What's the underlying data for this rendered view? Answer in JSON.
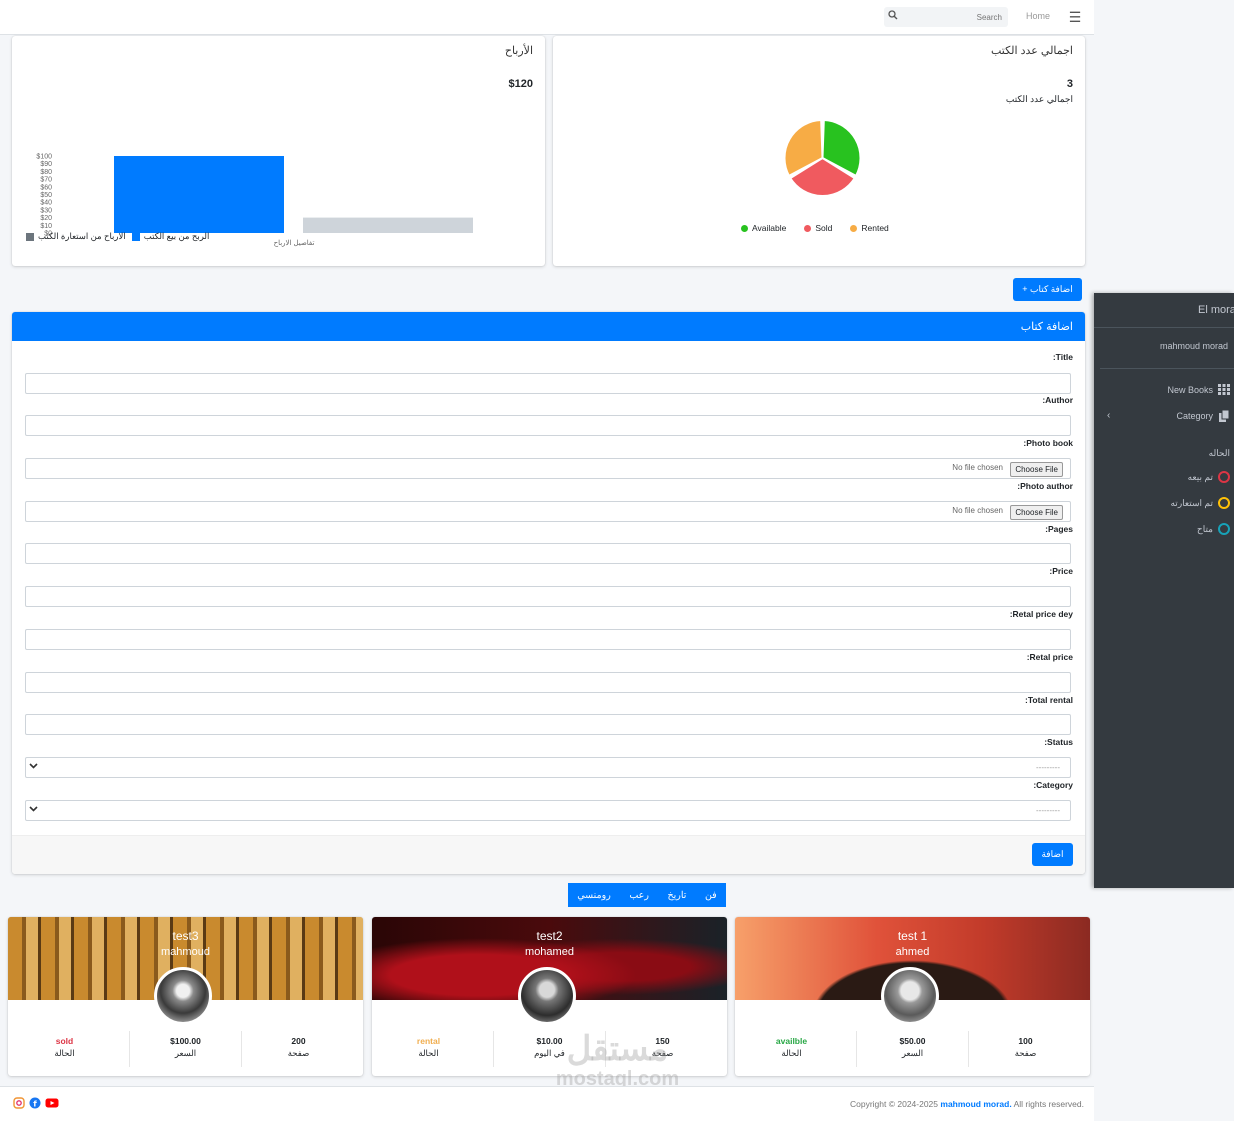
{
  "topbar": {
    "home_label": "Home",
    "search_placeholder": "Search"
  },
  "earnings_card": {
    "title": "الأرباح",
    "amount": "$120",
    "legend": [
      {
        "label": "الربح من بيع الكتب",
        "color": "#007bff"
      },
      {
        "label": "الارباح من استعارة الكتب",
        "color": "#6c757d"
      }
    ]
  },
  "books_card": {
    "title": "اجمالي عدد الكتب",
    "count": "3",
    "count_label": "اجمالي عدد الكتب",
    "legend": [
      {
        "label": "Available",
        "color": "#28c21f"
      },
      {
        "label": "Sold",
        "color": "#f05a5f"
      },
      {
        "label": "Rented",
        "color": "#f7ac45"
      }
    ]
  },
  "chart_data": [
    {
      "type": "bar",
      "categories": [
        "تفاصيل الارباح"
      ],
      "series": [
        {
          "name": "الربح من بيع الكتب",
          "values": [
            100
          ],
          "color": "#007bff"
        },
        {
          "name": "الارباح من استعارة الكتب",
          "values": [
            20
          ],
          "color": "#ced4da"
        }
      ],
      "yticks": [
        "$100",
        "$90",
        "$80",
        "$70",
        "$60",
        "$50",
        "$40",
        "$30",
        "$20",
        "$10",
        "$0"
      ],
      "ylim": [
        0,
        100
      ]
    },
    {
      "type": "pie",
      "labels": [
        "Available",
        "Sold",
        "Rented"
      ],
      "values": [
        1,
        1,
        1
      ],
      "colors": [
        "#28c21f",
        "#f05a5f",
        "#f7ac45"
      ]
    }
  ],
  "add_book_button": "+ اضافة كتاب",
  "form": {
    "header": "اضافة كتاب",
    "fields": [
      {
        "label": ":Title",
        "type": "text"
      },
      {
        "label": ":Author",
        "type": "text"
      },
      {
        "label": ":Photo book",
        "type": "file"
      },
      {
        "label": ":Photo author",
        "type": "file"
      },
      {
        "label": ":Pages",
        "type": "text"
      },
      {
        "label": ":Price",
        "type": "text"
      },
      {
        "label": ":Retal price dey",
        "type": "text"
      },
      {
        "label": ":Retal price",
        "type": "text"
      },
      {
        "label": ":Total rental",
        "type": "text"
      },
      {
        "label": ":Status",
        "type": "select"
      },
      {
        "label": ":Category",
        "type": "select"
      }
    ],
    "choose_file_label": "Choose File",
    "no_file_label": "No file chosen",
    "select_placeholder": "---------",
    "submit_label": "اضافة"
  },
  "genre_tabs": [
    "فن",
    "تاريخ",
    "رعب",
    "رومنسي"
  ],
  "books": [
    {
      "title": "test 1",
      "author": "ahmed",
      "status": "availble",
      "status_color": "#28a745",
      "status_label": "الحالة",
      "price": "$50.00",
      "price_label": "السعر",
      "pages": "100",
      "pages_label": "صفحة"
    },
    {
      "title": "test2",
      "author": "mohamed",
      "status": "rental",
      "status_color": "#f0ad4e",
      "status_label": "الحالة",
      "price": "$10.00",
      "price_label": "في اليوم",
      "pages": "150",
      "pages_label": "صفحة"
    },
    {
      "title": "test3",
      "author": "mahmoud",
      "status": "sold",
      "status_color": "#dc3545",
      "status_label": "الحالة",
      "price": "$100.00",
      "price_label": "السعر",
      "pages": "200",
      "pages_label": "صفحة"
    }
  ],
  "footer": {
    "copyright_prefix": "Copyright © 2024-2025",
    "author": "mahmoud morad.",
    "rights": "All rights reserved."
  },
  "sidebar": {
    "brand": "El morad",
    "user": "mahmoud morad",
    "items": [
      {
        "label": "New Books",
        "icon": "grid-icon"
      },
      {
        "label": "Category",
        "icon": "copy-icon"
      }
    ],
    "status_header": "الحاله",
    "statuses": [
      {
        "label": "تم بيعه",
        "color": "#dc3545"
      },
      {
        "label": "تم استعارته",
        "color": "#ffc107"
      },
      {
        "label": "متاح",
        "color": "#17a2b8"
      }
    ]
  },
  "watermark": {
    "line1": "مستقل",
    "line2": "mostaql.com"
  }
}
